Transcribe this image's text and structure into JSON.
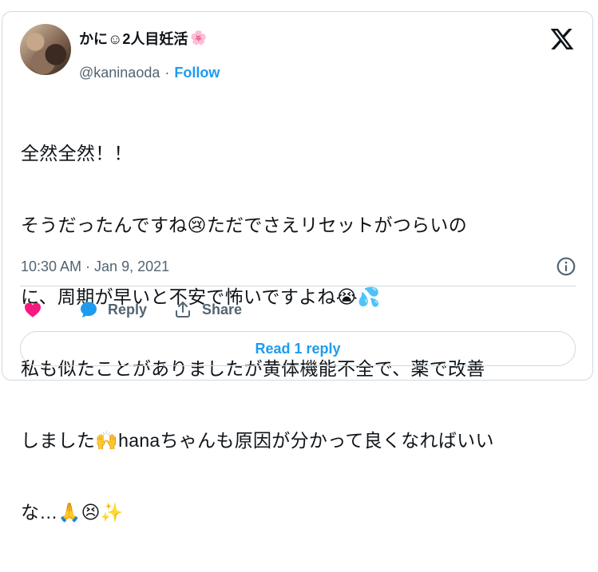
{
  "author": {
    "name": "かに☺2人目妊活",
    "name_emoji": "🌸",
    "handle": "@kaninaoda",
    "separator": "·",
    "follow_label": "Follow"
  },
  "tweet": {
    "lines": [
      "全然全然！！",
      "そうだったんですね😢ただでさえリセットがつらいの",
      "に、周期が早いと不安で怖いですよね😭💦",
      "私も似たことがありましたが黄体機能不全で、薬で改善",
      "しました🙌hanaちゃんも原因が分かって良くなればいい",
      "な…🙏😣✨"
    ],
    "timestamp": "10:30 AM · Jan 9, 2021"
  },
  "actions": {
    "reply_label": "Reply",
    "share_label": "Share"
  },
  "read_replies_label": "Read 1 reply",
  "icons": {
    "logo": "x-logo-icon",
    "info": "info-icon",
    "like": "heart-icon",
    "reply": "reply-bubble-icon",
    "share": "share-icon"
  },
  "colors": {
    "accent": "#1d9bf0",
    "heart": "#f91880",
    "muted": "#536471",
    "border": "#cfd9de"
  }
}
